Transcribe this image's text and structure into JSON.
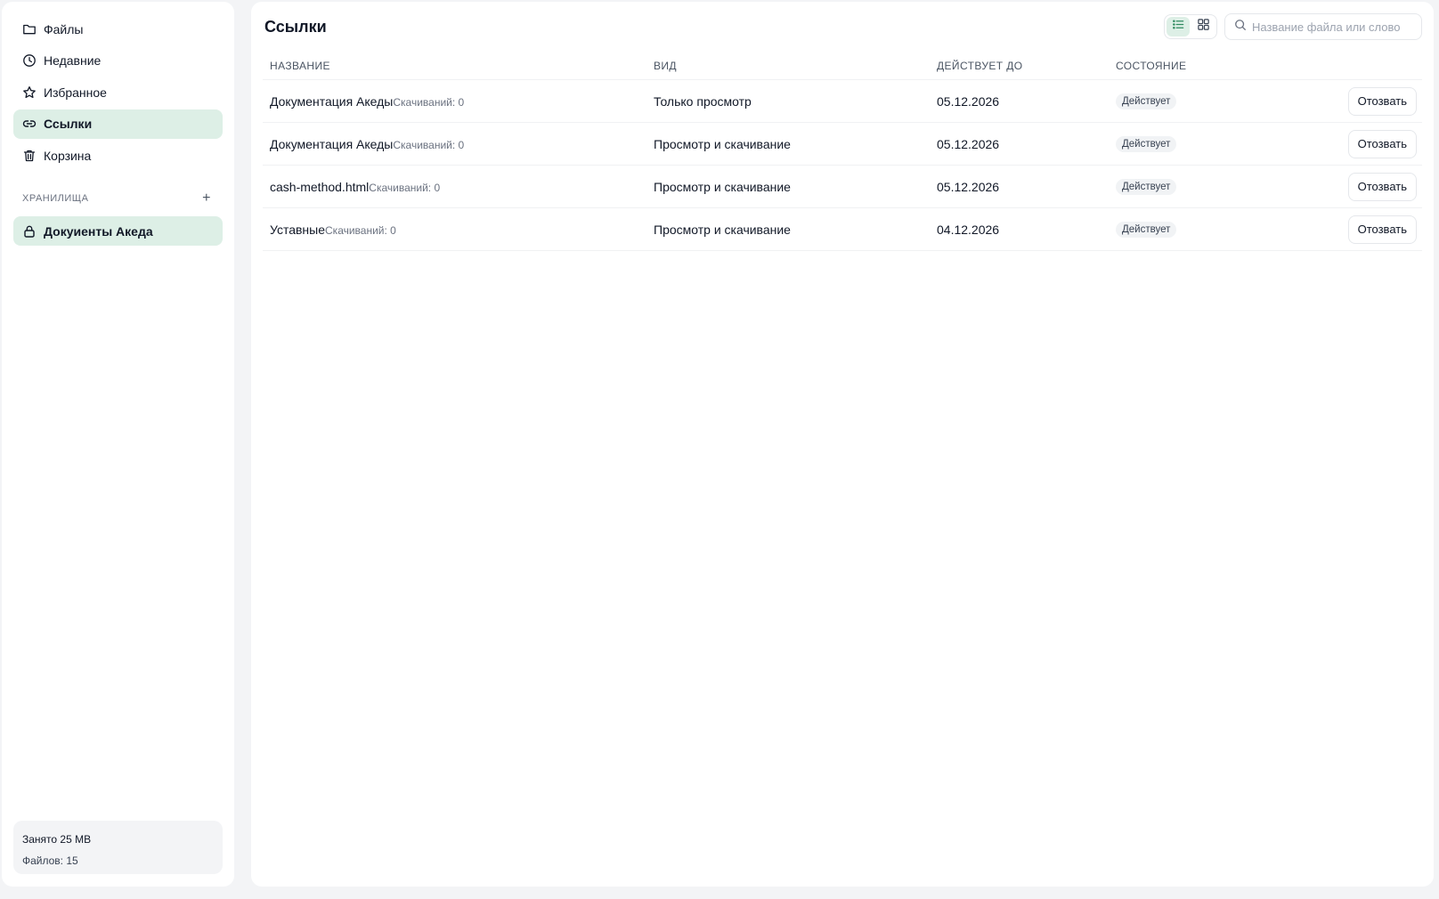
{
  "sidebar": {
    "nav": [
      {
        "label": "Файлы",
        "icon": "folder-icon"
      },
      {
        "label": "Недавние",
        "icon": "clock-icon"
      },
      {
        "label": "Избранное",
        "icon": "star-icon"
      },
      {
        "label": "Ссылки",
        "icon": "link-icon",
        "active": true
      },
      {
        "label": "Корзина",
        "icon": "trash-icon"
      }
    ],
    "storages_header": "Хранилища",
    "add_icon": "+",
    "storages": [
      {
        "label": "Докуиенты Акеда",
        "icon": "lock-icon"
      }
    ],
    "usage": {
      "used": "Занято 25 MB",
      "files": "Файлов: 15"
    }
  },
  "main": {
    "title": "Ссылки",
    "view_modes": [
      {
        "name": "list",
        "icon": "list-icon",
        "active": true
      },
      {
        "name": "grid",
        "icon": "grid-icon",
        "active": false
      }
    ],
    "search": {
      "placeholder": "Название файла или слово",
      "value": ""
    },
    "table": {
      "columns": [
        "Название",
        "Вид",
        "Действует до",
        "Состояние"
      ],
      "rows": [
        {
          "name": "Документация Акеды",
          "downloads": "Скачиваний: 0",
          "type": "Только просмотр",
          "expires": "05.12.2026",
          "status": "Действует",
          "action": "Отозвать"
        },
        {
          "name": "Документация Акеды",
          "downloads": "Скачиваний: 0",
          "type": "Просмотр и скачивание",
          "expires": "05.12.2026",
          "status": "Действует",
          "action": "Отозвать"
        },
        {
          "name": "cash-method.html",
          "downloads": "Скачиваний: 0",
          "type": "Просмотр и скачивание",
          "expires": "05.12.2026",
          "status": "Действует",
          "action": "Отозвать"
        },
        {
          "name": "Уставные",
          "downloads": "Скачиваний: 0",
          "type": "Просмотр и скачивание",
          "expires": "04.12.2026",
          "status": "Действует",
          "action": "Отозвать"
        }
      ]
    }
  },
  "colors": {
    "accent_bg": "#ddefe6",
    "page_bg": "#f3f4f6",
    "accent": "#2f8a5f"
  }
}
